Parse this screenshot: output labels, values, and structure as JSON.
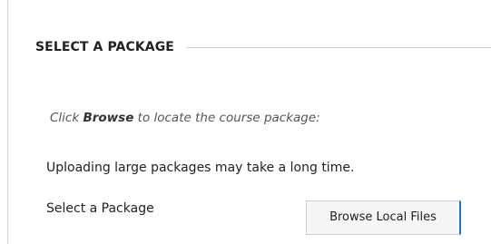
{
  "section": {
    "title": "SELECT A PACKAGE"
  },
  "instructions": {
    "prefix": "Click ",
    "emphasis": "Browse",
    "suffix": " to locate the course package:"
  },
  "notice": {
    "text": "Uploading large packages may take a long time."
  },
  "package_field": {
    "label": "Select a Package",
    "button_label": "Browse Local Files"
  },
  "colors": {
    "button_accent": "#2a6fb0"
  }
}
